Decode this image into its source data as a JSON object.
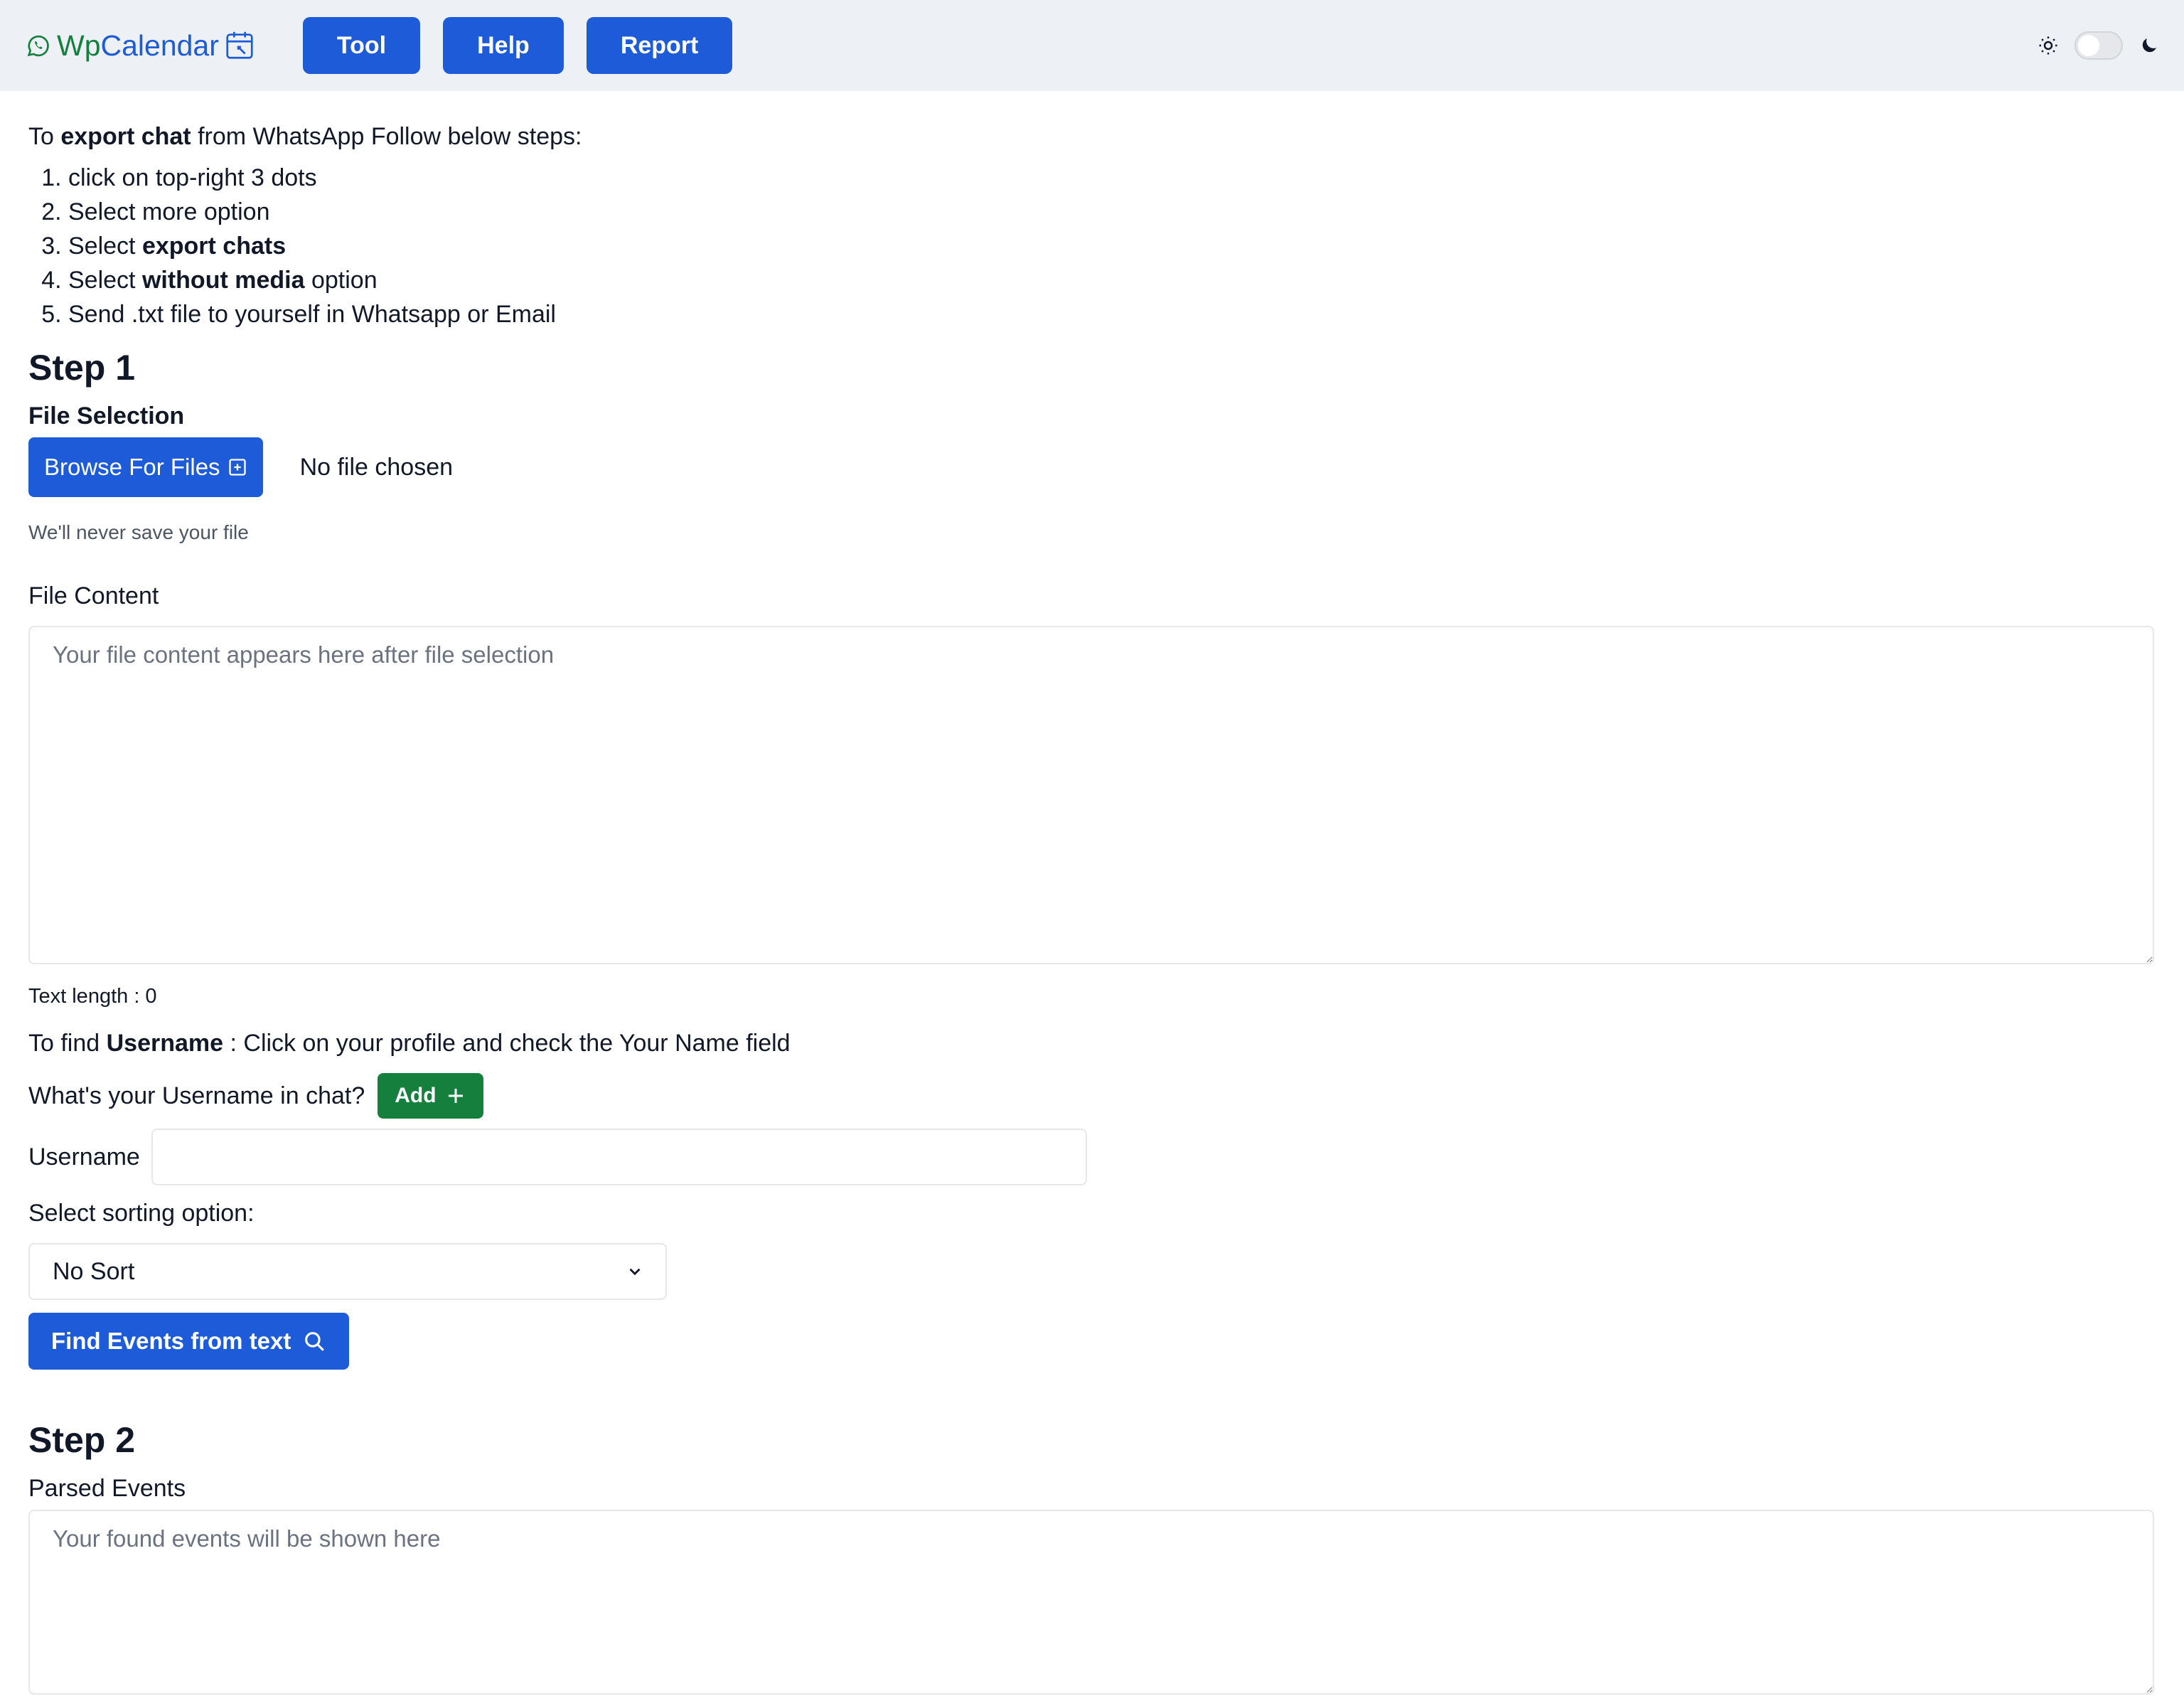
{
  "navbar": {
    "brand_wp": "Wp",
    "brand_calendar": "Calendar",
    "buttons": [
      "Tool",
      "Help",
      "Report"
    ]
  },
  "intro": {
    "pre": "To ",
    "bold": "export chat",
    "post": " from WhatsApp Follow below steps:",
    "steps": [
      {
        "pre": "click on top-right 3 dots",
        "bold": "",
        "post": ""
      },
      {
        "pre": "Select more option",
        "bold": "",
        "post": ""
      },
      {
        "pre": "Select ",
        "bold": "export chats",
        "post": ""
      },
      {
        "pre": "Select ",
        "bold": "without media",
        "post": " option"
      },
      {
        "pre": "Send .txt file to yourself in Whatsapp or Email",
        "bold": "",
        "post": ""
      }
    ]
  },
  "step1": {
    "title": "Step 1",
    "file_selection_label": "File Selection",
    "browse_label": "Browse For Files",
    "file_status": "No file chosen",
    "hint": "We'll never save your file",
    "file_content_label": "File Content",
    "file_content_placeholder": "Your file content appears here after file selection",
    "text_length_label": "Text length : 0",
    "find_username": {
      "pre": "To find ",
      "bold": "Username",
      "post": " : Click on your profile and check the Your Name field"
    },
    "username_question": "What's your Username in chat?",
    "add_label": "Add",
    "username_label": "Username",
    "username_value": "",
    "sort_label": "Select sorting option:",
    "sort_selected": "No Sort",
    "find_events_label": "Find Events from text"
  },
  "step2": {
    "title": "Step 2",
    "parsed_label": "Parsed Events",
    "parsed_placeholder": "Your found events will be shown here"
  },
  "colors": {
    "primary": "#1d5bd8",
    "success": "#15803d",
    "navbar_bg": "#edf1f5"
  },
  "icons": [
    "whatsapp-icon",
    "calendar-icon",
    "sun-icon",
    "moon-icon",
    "plus-square-icon",
    "plus-icon",
    "search-icon",
    "chevron-down-icon"
  ]
}
